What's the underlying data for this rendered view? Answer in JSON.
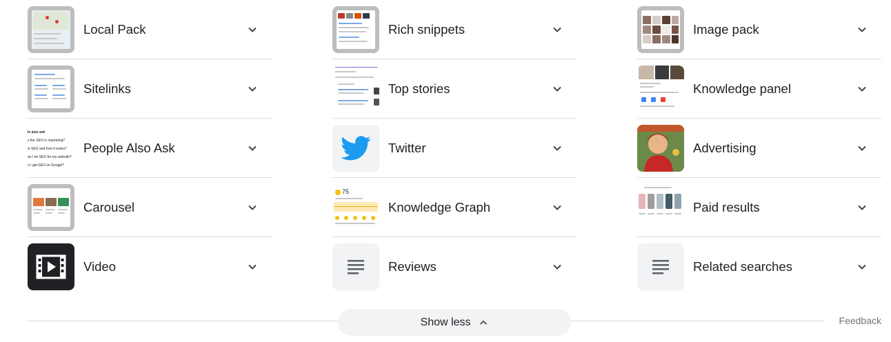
{
  "columns": [
    {
      "items": [
        {
          "label": "Local Pack",
          "thumb": "map-screenshot"
        },
        {
          "label": "Sitelinks",
          "thumb": "sitelinks-screenshot"
        },
        {
          "label": "People Also Ask",
          "thumb": "paa-screenshot",
          "thumb_text": [
            "le also ask",
            "s the SEO in marketing?",
            "is SEO and how it works?",
            "an I do SEO for my website?",
            "n I get SEO on Google?"
          ]
        },
        {
          "label": "Carousel",
          "thumb": "carousel-screenshot"
        },
        {
          "label": "Video",
          "thumb": "film-play-icon"
        }
      ]
    },
    {
      "items": [
        {
          "label": "Rich snippets",
          "thumb": "rich-snippet-screenshot"
        },
        {
          "label": "Top stories",
          "thumb": "top-stories-screenshot"
        },
        {
          "label": "Twitter",
          "thumb": "twitter-bird-icon"
        },
        {
          "label": "Knowledge Graph",
          "thumb": "weather-screenshot",
          "thumb_text": [
            "75"
          ]
        },
        {
          "label": "Reviews",
          "thumb": "lines-icon"
        }
      ]
    },
    {
      "items": [
        {
          "label": "Image pack",
          "thumb": "image-grid-screenshot"
        },
        {
          "label": "Knowledge panel",
          "thumb": "knowledge-panel-screenshot"
        },
        {
          "label": "Advertising",
          "thumb": "vintage-ad-image"
        },
        {
          "label": "Paid results",
          "thumb": "luggage-ads-screenshot"
        },
        {
          "label": "Related searches",
          "thumb": "lines-icon"
        }
      ]
    }
  ],
  "show_less_label": "Show less",
  "feedback_label": "Feedback",
  "colors": {
    "text": "#202124",
    "divider": "#dadce0",
    "button_bg": "#f1f3f4",
    "twitter_blue": "#1d9bf0",
    "muted": "#70757a"
  }
}
